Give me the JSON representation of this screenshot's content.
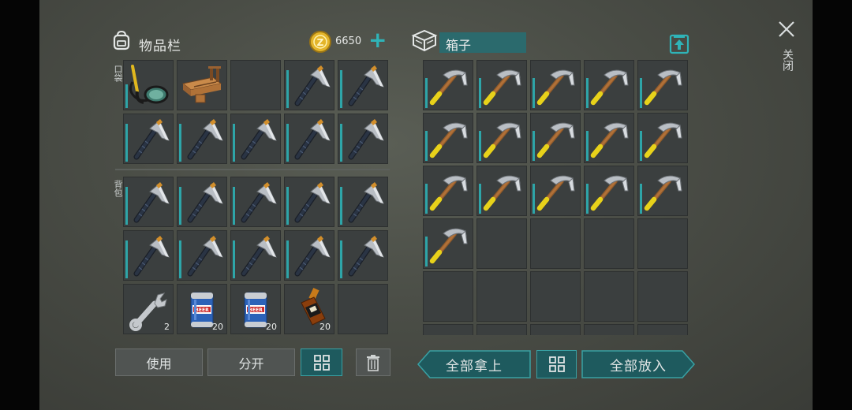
{
  "inventory": {
    "title": "物品栏",
    "coins": "6650",
    "add_label": "+",
    "section_pocket": "口袋",
    "section_backpack": "背包",
    "slots": [
      {
        "item": "scuba-mask-icon",
        "qty": ""
      },
      {
        "item": "workbench-icon",
        "qty": ""
      },
      {
        "item": "",
        "qty": ""
      },
      {
        "item": "steel-axe-icon",
        "qty": ""
      },
      {
        "item": "steel-axe-icon",
        "qty": ""
      },
      {
        "item": "steel-axe-icon",
        "qty": ""
      },
      {
        "item": "steel-axe-icon",
        "qty": ""
      },
      {
        "item": "steel-axe-icon",
        "qty": ""
      },
      {
        "item": "steel-axe-icon",
        "qty": ""
      },
      {
        "item": "steel-axe-icon",
        "qty": ""
      },
      {
        "item": "steel-axe-icon",
        "qty": ""
      },
      {
        "item": "steel-axe-icon",
        "qty": ""
      },
      {
        "item": "steel-axe-icon",
        "qty": ""
      },
      {
        "item": "steel-axe-icon",
        "qty": ""
      },
      {
        "item": "steel-axe-icon",
        "qty": ""
      },
      {
        "item": "steel-axe-icon",
        "qty": ""
      },
      {
        "item": "steel-axe-icon",
        "qty": ""
      },
      {
        "item": "steel-axe-icon",
        "qty": ""
      },
      {
        "item": "steel-axe-icon",
        "qty": ""
      },
      {
        "item": "steel-axe-icon",
        "qty": ""
      },
      {
        "item": "wrench-icon",
        "qty": "2"
      },
      {
        "item": "beer-can-icon",
        "qty": "20"
      },
      {
        "item": "beer-can-icon",
        "qty": "20"
      },
      {
        "item": "whiskey-bottle-icon",
        "qty": "20"
      },
      {
        "item": "",
        "qty": ""
      }
    ],
    "use_label": "使用",
    "split_label": "分开"
  },
  "box": {
    "title": "箱子",
    "slots": [
      "pickaxe-icon",
      "pickaxe-icon",
      "pickaxe-icon",
      "pickaxe-icon",
      "pickaxe-icon",
      "pickaxe-icon",
      "pickaxe-icon",
      "pickaxe-icon",
      "pickaxe-icon",
      "pickaxe-icon",
      "pickaxe-icon",
      "pickaxe-icon",
      "pickaxe-icon",
      "pickaxe-icon",
      "pickaxe-icon",
      "pickaxe-icon",
      "",
      "",
      "",
      "",
      "",
      "",
      "",
      "",
      "",
      "",
      "",
      "",
      "",
      ""
    ],
    "take_all_label": "全部拿上",
    "put_all_label": "全部放入"
  },
  "close_label": "关闭",
  "colors": {
    "accent": "#2ea5a8",
    "panel": "#3b3f3f",
    "gold": "#e4b52a"
  }
}
